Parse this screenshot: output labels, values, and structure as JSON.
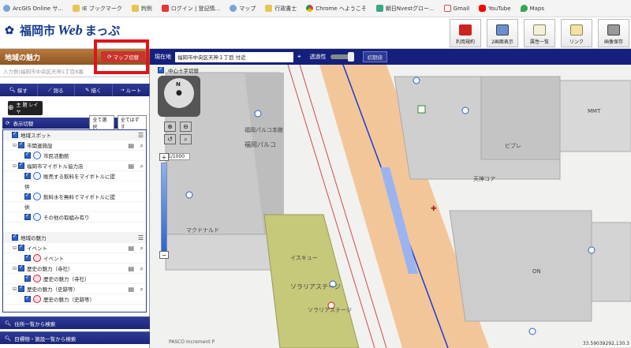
{
  "bookmarks": [
    {
      "label": "ArcGIS Online サ...",
      "icon": "globe-icon"
    },
    {
      "label": "IE ブックマーク",
      "icon": "folder-icon"
    },
    {
      "label": "判例",
      "icon": "folder-icon"
    },
    {
      "label": "ログイン | 登記情...",
      "icon": "login-icon"
    },
    {
      "label": "マップ",
      "icon": "globe-icon"
    },
    {
      "label": "行政書士",
      "icon": "folder-icon"
    },
    {
      "label": "Chrome へようこそ",
      "icon": "chrome-icon"
    },
    {
      "label": "朝日Nvestグロー...",
      "icon": "news-icon"
    },
    {
      "label": "Gmail",
      "icon": "gmail-icon"
    },
    {
      "label": "YouTube",
      "icon": "youtube-icon"
    },
    {
      "label": "Maps",
      "icon": "maps-icon"
    }
  ],
  "header": {
    "logo_city": "福岡市",
    "logo_web": "Web",
    "logo_suffix": "まっぷ",
    "buttons": [
      {
        "label": "利用規約",
        "icon": "book-icon"
      },
      {
        "label": "2画面表示",
        "icon": "two-screen-icon"
      },
      {
        "label": "属性一覧",
        "icon": "list-icon"
      },
      {
        "label": "リンク",
        "icon": "link-icon"
      },
      {
        "label": "画像保存",
        "icon": "save-image-icon"
      }
    ]
  },
  "left_panel": {
    "title": "地域の魅力",
    "map_switch_label": "マップ切替",
    "search_placeholder": "入力例)福岡市中央区天神1丁目8番",
    "badge": "",
    "tools": [
      "探す",
      "測る",
      "描く",
      "ルート"
    ],
    "layer_button": "主 題 レイヤ",
    "toggle_title": "表示切替",
    "select_all": "全て選択",
    "deselect_all": "全てはずす",
    "tree": [
      {
        "label": "地域スポット",
        "level": 0,
        "group": true
      },
      {
        "label": "市関連施設",
        "level": 1
      },
      {
        "label": "市民活動館",
        "level": 2,
        "symbol": "blue"
      },
      {
        "label": "福岡市マイボトル協力店",
        "level": 1
      },
      {
        "label": "販売する飲料をマイボトルに提",
        "level": 2,
        "symbol": "blue"
      },
      {
        "label": "供",
        "level": 3
      },
      {
        "label": "飲料水を無料でマイボトルに提",
        "level": 2,
        "symbol": "blue"
      },
      {
        "label": "供",
        "level": 3
      },
      {
        "label": "その他の取組み有り",
        "level": 2,
        "symbol": "blue"
      },
      {
        "label": "",
        "level": 3
      },
      {
        "label": "地域の魅力",
        "level": 0,
        "group": true
      },
      {
        "label": "イベント",
        "level": 1
      },
      {
        "label": "イベント",
        "level": 2,
        "symbol": "red"
      },
      {
        "label": "歴史の魅力（寺社）",
        "level": 1
      },
      {
        "label": "歴史の魅力（寺社）",
        "level": 2,
        "symbol": "red"
      },
      {
        "label": "歴史の魅力（史跡等）",
        "level": 1
      },
      {
        "label": "歴史の魅力（史跡等）",
        "level": 2,
        "symbol": "red"
      }
    ],
    "bottom1": "住所一覧から検索",
    "bottom2": "目標物・施設一覧から検索"
  },
  "map_bar": {
    "location_label": "現在地",
    "location_value": "福岡市中央区天神１丁目 付近",
    "opacity_label": "透過性",
    "reset_label": "初期値"
  },
  "map": {
    "center_cross_label": "中心十字切替",
    "scale": "1/1000",
    "labels": [
      "福岡パルコ本館",
      "福岡パルコ",
      "マクドナルド",
      "イスキュー",
      "ソラリアステージ",
      "ソラリアステージ",
      "天神コア",
      "ビブレ",
      "MMT",
      "ON"
    ],
    "coordinate": "33.59039292,130.3",
    "credit": "PASCO Increment P"
  }
}
